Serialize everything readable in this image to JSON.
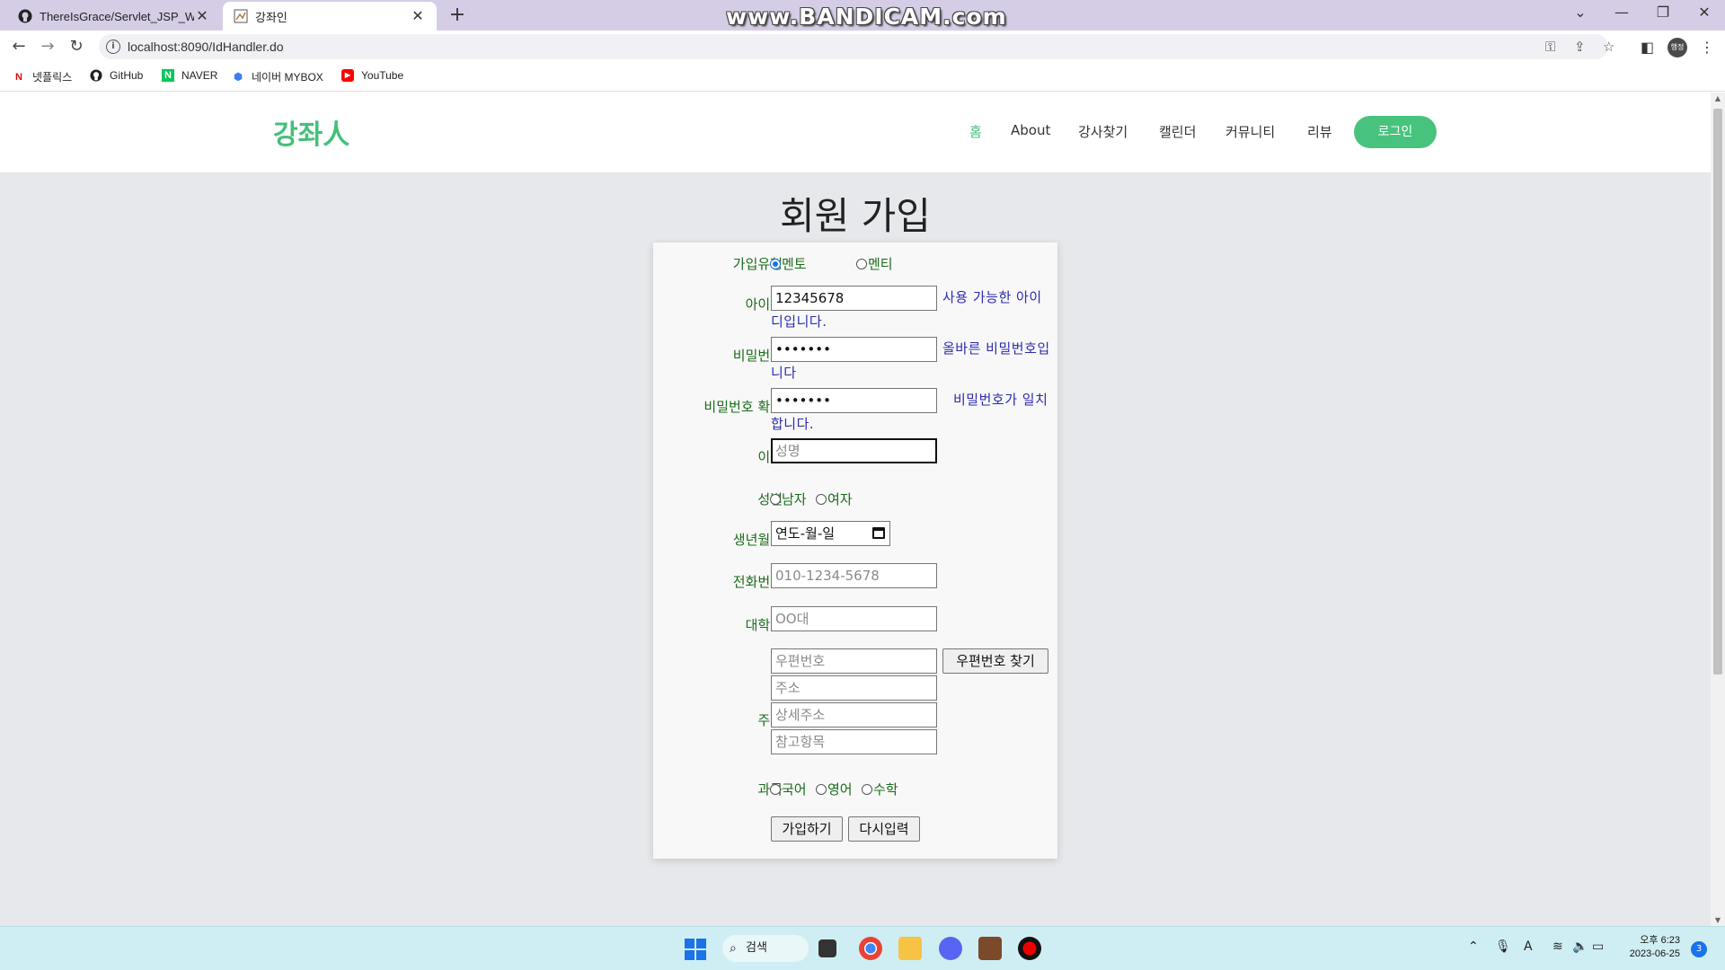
{
  "browser": {
    "tabs": [
      {
        "title": "ThereIsGrace/Servlet_JSP_WebS",
        "icon": "github-icon",
        "active": false
      },
      {
        "title": "강좌인",
        "icon": "page-icon",
        "active": true
      }
    ],
    "watermark": "www.BANDICAM.com",
    "url": "localhost:8090/IdHandler.do",
    "profile_label": "행정"
  },
  "bookmarks": [
    {
      "label": "넷플릭스",
      "icon": "netflix-icon"
    },
    {
      "label": "GitHub",
      "icon": "github-icon"
    },
    {
      "label": "NAVER",
      "icon": "naver-icon"
    },
    {
      "label": "네이버 MYBOX",
      "icon": "mybox-icon"
    },
    {
      "label": "YouTube",
      "icon": "youtube-icon"
    }
  ],
  "site": {
    "logo": "강좌人",
    "nav": [
      {
        "label": "홈",
        "active": true
      },
      {
        "label": "About",
        "active": false
      },
      {
        "label": "강사찾기",
        "active": false
      },
      {
        "label": "캘린더",
        "active": false
      },
      {
        "label": "커뮤니티",
        "active": false
      },
      {
        "label": "리뷰",
        "active": false
      }
    ],
    "login_label": "로그인"
  },
  "form": {
    "title": "회원 가입",
    "join_type": {
      "label": "가입유형",
      "options": [
        "멘토",
        "멘티"
      ],
      "selected": "멘토"
    },
    "user_id": {
      "label": "아이디",
      "value": "12345678",
      "message": "사용 가능한 아이디입니다."
    },
    "password": {
      "label": "비밀번호",
      "value": "•••••••",
      "message": "올바른 비밀번호입니다"
    },
    "password_confirm": {
      "label": "비밀번호 확인",
      "value": "•••••••",
      "message": "비밀번호가 일치합니다."
    },
    "name": {
      "label": "이름",
      "placeholder": "성명"
    },
    "gender": {
      "label": "성별",
      "options": [
        "남자",
        "여자"
      ]
    },
    "birth": {
      "label": "생년월일",
      "value": "연도-월-일"
    },
    "phone": {
      "label": "전화번호",
      "placeholder": "010-1234-5678"
    },
    "university": {
      "label": "대학교",
      "placeholder": "OO대"
    },
    "address": {
      "label": "주소",
      "postcode_placeholder": "우편번호",
      "find_button": "우편번호 찾기",
      "address_placeholder": "주소",
      "detail_placeholder": "상세주소",
      "extra_placeholder": "참고항목"
    },
    "subject": {
      "label": "과목",
      "options": [
        "국어",
        "영어",
        "수학"
      ]
    },
    "submit_label": "가입하기",
    "reset_label": "다시입력"
  },
  "taskbar": {
    "search_label": "검색",
    "time": "오후 6:23",
    "date": "2023-06-25",
    "notifications": "3"
  },
  "colors": {
    "brand_green": "#44c07a",
    "label_green": "#1a6b1a",
    "message_blue": "#2b2bb0"
  }
}
